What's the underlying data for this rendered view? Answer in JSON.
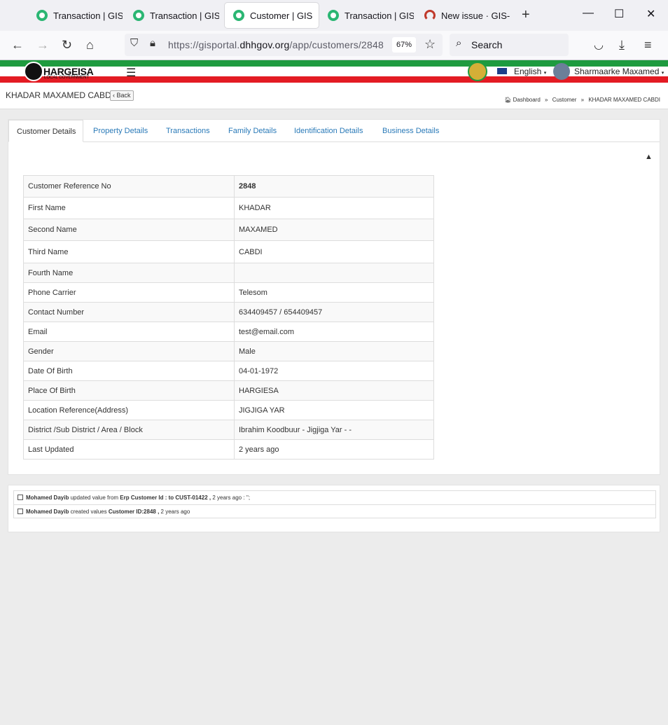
{
  "browser": {
    "tabs": [
      {
        "title": "Transaction | GIS P",
        "favicon": "gis-favicon"
      },
      {
        "title": "Transaction | GIS P",
        "favicon": "gis-favicon"
      },
      {
        "title": "Customer | GIS",
        "favicon": "gis-favicon",
        "active": true
      },
      {
        "title": "Transaction | GIS P",
        "favicon": "gis-favicon"
      },
      {
        "title": "New issue · GIS-H",
        "favicon": "redmine-favicon"
      }
    ],
    "url_prefix": "https://gisportal.",
    "url_domain": "dhhgov.org",
    "url_path": "/app/customers/2848",
    "zoom": "67%",
    "search_placeholder": "Search"
  },
  "app": {
    "logo_text": "HARGEISA",
    "logo_sub": "LOCAL GOVERNMENT",
    "language": "English",
    "user": "Sharmaarke Maxamed"
  },
  "page": {
    "title": "KHADAR MAXAMED CABDI",
    "back_label": "Back",
    "breadcrumbs": [
      "Dashboard",
      "Customer",
      "KHADAR MAXAMED CABDI"
    ]
  },
  "tabs": [
    "Customer Details",
    "Property Details",
    "Transactions",
    "Family Details",
    "Identification Details",
    "Business Details"
  ],
  "details": [
    {
      "label": "Customer Reference No",
      "value": "2848"
    },
    {
      "label": "First Name",
      "value": "KHADAR"
    },
    {
      "label": "Second Name",
      "value": "MAXAMED"
    },
    {
      "label": "Third Name",
      "value": "CABDI"
    },
    {
      "label": "Fourth Name",
      "value": ""
    },
    {
      "label": "Phone Carrier",
      "value": "Telesom"
    },
    {
      "label": "Contact Number",
      "value": "634409457 / 654409457"
    },
    {
      "label": "Email",
      "value": "test@email.com"
    },
    {
      "label": "Gender",
      "value": "Male"
    },
    {
      "label": "Date Of Birth",
      "value": "04-01-1972"
    },
    {
      "label": "Place Of Birth",
      "value": "HARGIESA"
    },
    {
      "label": "Location Reference(Address)",
      "value": "JIGJIGA YAR"
    },
    {
      "label": "District /Sub District / Area / Block",
      "value": "Ibrahim Koodbuur - Jigjiga Yar - -"
    },
    {
      "label": "Last Updated",
      "value": "2 years ago"
    }
  ],
  "activity": [
    {
      "user": "Mohamed Dayib",
      "action": " updated value from ",
      "field": "Erp Customer Id : to CUST-01422 ,",
      "time": " 2 years ago : '';"
    },
    {
      "user": "Mohamed Dayib",
      "action": " created values ",
      "field": "Customer ID:2848 ,",
      "time": " 2 years ago"
    }
  ],
  "colors": {
    "link": "#2a7ab8",
    "flag_green": "#1e9b3f",
    "flag_red": "#e31b23"
  }
}
